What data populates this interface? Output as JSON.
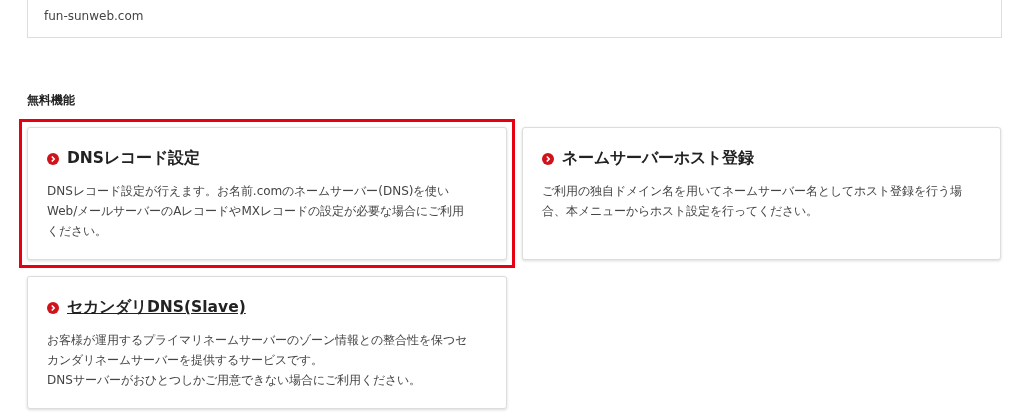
{
  "domain": {
    "value": "fun-sunweb.com"
  },
  "section": {
    "title": "無料機能",
    "cards": [
      {
        "title": "DNSレコード設定",
        "highlighted": true,
        "underlined": false,
        "description": "DNSレコード設定が行えます。お名前.comのネームサーバー(DNS)を使いWeb/メールサーバーのAレコードやMXレコードの設定が必要な場合にご利用ください。"
      },
      {
        "title": "ネームサーバーホスト登録",
        "highlighted": false,
        "underlined": false,
        "description": "ご利用の独自ドメイン名を用いてネームサーバー名としてホスト登録を行う場合、本メニューからホスト設定を行ってください。"
      },
      {
        "title": "セカンダリDNS(Slave)",
        "highlighted": false,
        "underlined": true,
        "description": "お客様が運用するプライマリネームサーバーのゾーン情報との整合性を保つセカンダリネームサーバーを提供するサービスです。\nDNSサーバーがおひとつしかご用意できない場合にご利用ください。"
      }
    ]
  }
}
